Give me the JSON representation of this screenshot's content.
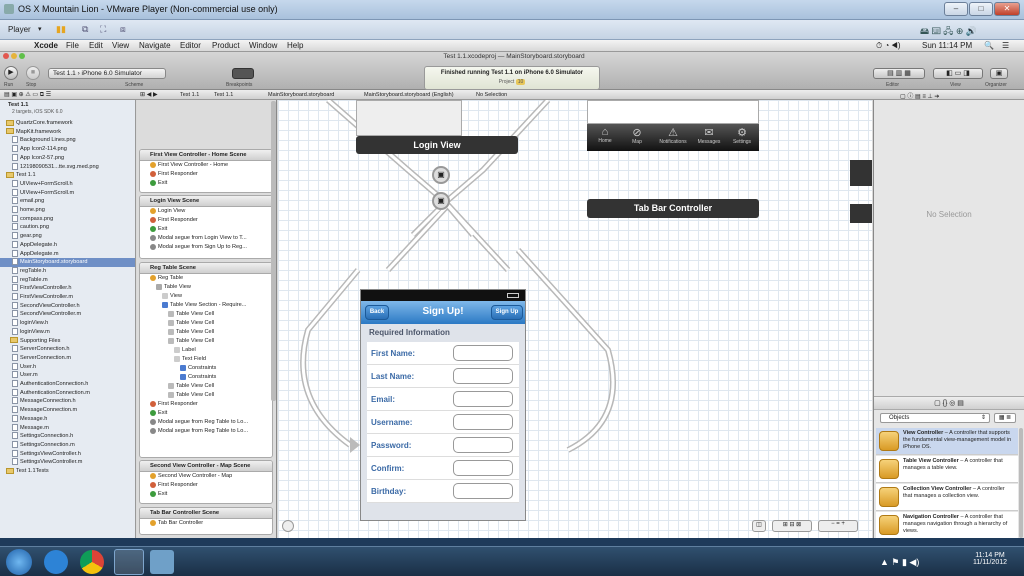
{
  "vmware": {
    "title": "OS X Mountain Lion - VMware Player (Non-commercial use only)",
    "player_menu": "Player"
  },
  "mac_menu": {
    "app": "Xcode",
    "items": [
      "File",
      "Edit",
      "View",
      "Navigate",
      "Editor",
      "Product",
      "Window",
      "Help"
    ],
    "clock": "Sun 11:14 PM"
  },
  "toolbar": {
    "scheme": "Test 1.1",
    "destination": "iPhone 6.0 Simulator",
    "run": "Run",
    "stop": "Stop",
    "scheme_label": "Scheme",
    "breakpoints": "Breakpoints",
    "editor": "Editor",
    "view": "View",
    "organizer": "Organizer"
  },
  "status": {
    "title": "Test 1.1.xcodeproj — MainStoryboard.storyboard",
    "message": "Finished running Test 1.1 on iPhone 6.0 Simulator",
    "project": "Project",
    "count": "10"
  },
  "jump_bar": {
    "items": [
      "Test 1.1",
      "Test 1.1",
      "MainStoryboard.storyboard",
      "MainStoryboard.storyboard (English)",
      "No Selection"
    ]
  },
  "navigator": {
    "project": "Test 1.1",
    "project_sub": "2 targets, iOS SDK 6.0",
    "files": [
      "QuartzCore.framework",
      "MapKit.framework",
      "Background Lines.png",
      "App Icon2-114.png",
      "App Icon2-57.png",
      "12198090531...tte.svg.med.png",
      "Test 1.1",
      "UIView+FormScroll.h",
      "UIView+FormScroll.m",
      "email.png",
      "home.png",
      "compass.png",
      "caution.png",
      "gear.png",
      "AppDelegate.h",
      "AppDelegate.m",
      "MainStoryboard.storyboard",
      "regTable.h",
      "regTable.m",
      "FirstViewController.h",
      "FirstViewController.m",
      "SecondViewController.h",
      "SecondViewController.m",
      "loginView.h",
      "loginView.m",
      "Supporting Files",
      "ServerConnection.h",
      "ServerConnection.m",
      "User.h",
      "User.m",
      "AuthenticationConnection.h",
      "AuthenticationConnection.m",
      "MessageConnection.h",
      "MessageConnection.m",
      "Message.h",
      "Message.m",
      "SettingsConnection.h",
      "SettingsConnection.m",
      "SettingsViewController.h",
      "SettingsViewController.m",
      "Test 1.1Tests"
    ]
  },
  "outline": {
    "scenes": [
      {
        "title": "First View Controller - Home Scene",
        "items": [
          "First View Controller - Home",
          "First Responder",
          "Exit"
        ]
      },
      {
        "title": "Login View Scene",
        "items": [
          "Login View",
          "First Responder",
          "Exit",
          "Modal segue from Login View to T...",
          "Modal segue from Sign Up to Reg..."
        ]
      },
      {
        "title": "Reg Table Scene",
        "items": [
          "Reg Table",
          "Table View",
          "View",
          "Table View Section - Require...",
          "Table View Cell",
          "Table View Cell",
          "Table View Cell",
          "Table View Cell",
          "Label",
          "Text Field",
          "Constraints",
          "Constraints",
          "Table View Cell",
          "Table View Cell",
          "First Responder",
          "Exit",
          "Modal segue from Reg Table to Lo...",
          "Modal segue from Reg Table to Lo..."
        ]
      },
      {
        "title": "Second View Controller - Map Scene",
        "items": [
          "Second View Controller - Map",
          "First Responder",
          "Exit"
        ]
      },
      {
        "title": "Tab Bar Controller Scene",
        "items": [
          "Tab Bar Controller"
        ]
      }
    ]
  },
  "canvas": {
    "login_view": "Login View",
    "tab_bar_controller": "Tab Bar Controller",
    "tabs": [
      "Home",
      "Map",
      "Notifications",
      "Messages",
      "Settings"
    ],
    "signup": {
      "back": "Back",
      "title": "Sign Up!",
      "action": "Sign Up",
      "section": "Required Information",
      "fields": [
        "First Name:",
        "Last Name:",
        "Email:",
        "Username:",
        "Password:",
        "Confirm:",
        "Birthday:"
      ]
    }
  },
  "utilities": {
    "no_selection": "No Selection",
    "library_filter": "Objects",
    "library": [
      {
        "title": "View Controller",
        "desc": "A controller that supports the fundamental view-management model in iPhone OS."
      },
      {
        "title": "Table View Controller",
        "desc": "A controller that manages a table view."
      },
      {
        "title": "Collection View Controller",
        "desc": "A controller that manages a collection view."
      },
      {
        "title": "Navigation Controller",
        "desc": "A controller that manages navigation through a hierarchy of views."
      }
    ]
  },
  "windows_taskbar": {
    "time": "11:14 PM",
    "date": "11/11/2012"
  }
}
